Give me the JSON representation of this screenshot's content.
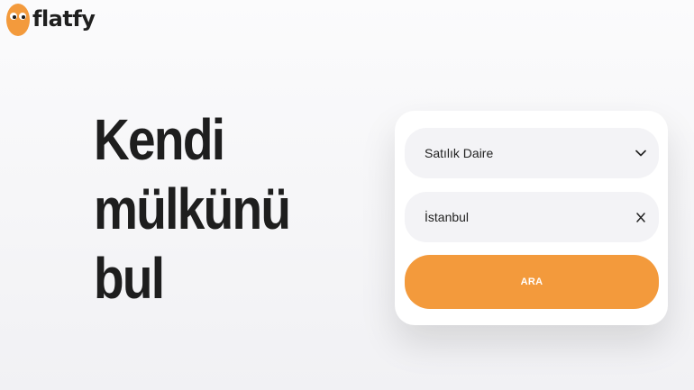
{
  "brand": {
    "name": "flatfy",
    "accent_color": "#f39a3c"
  },
  "hero": {
    "lines": [
      "Kendi",
      "mülkünü",
      "bul"
    ]
  },
  "search_form": {
    "property_type": {
      "value": "Satılık Daire",
      "icon": "chevron-down-icon"
    },
    "location": {
      "value": "İstanbul",
      "icon": "close-icon"
    },
    "submit_label": "ARA"
  }
}
